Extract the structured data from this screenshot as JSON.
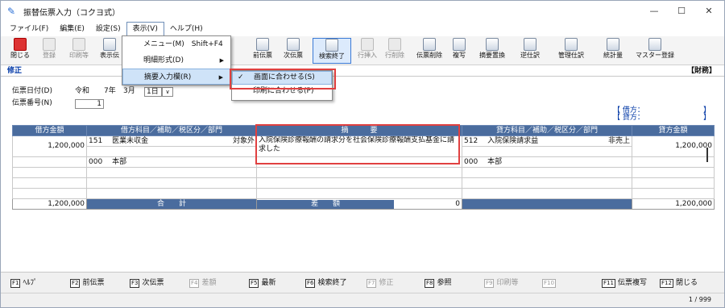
{
  "window": {
    "title": "振替伝票入力（コクヨ式）",
    "min": "—",
    "max": "☐",
    "close": "✕"
  },
  "menu": [
    "ファイル(F)",
    "編集(E)",
    "設定(S)",
    "表示(V)",
    "ヘルプ(H)"
  ],
  "toolbar": [
    "閉じる",
    "登録",
    "印刷等",
    "表示伝",
    "前伝票",
    "次伝票",
    "検索終了",
    "行挿入",
    "行削除",
    "伝票削除",
    "複写",
    "摘要置換",
    "逆仕訳",
    "管理仕訳",
    "統計量",
    "マスター登録"
  ],
  "mode": "修正",
  "dept": "【財務】",
  "header": {
    "date_label": "伝票日付(D)",
    "era": "令和",
    "year": "7年",
    "month": "3月",
    "day": "1日",
    "number_label": "伝票番号(N)",
    "number": "1"
  },
  "side": {
    "debit_label": "【 借方：",
    "credit_label": "【 貸方：",
    "close": "】"
  },
  "grid": {
    "cols": [
      "借方金額",
      "借方科目／補助／税区分／部門",
      "摘　　　要",
      "貸方科目／補助／税区分／部門",
      "貸方金額"
    ],
    "debit_amount": "1,200,000",
    "debit_code": "151",
    "debit_account": "医業未収金",
    "debit_tax": "対象外",
    "debit_dept_code": "000",
    "debit_dept": "本部",
    "memo": "入院保険診療報酬の請求分を社会保険診療報酬支払基金に請求した",
    "credit_code": "512",
    "credit_account": "入院保険請求益",
    "credit_tax": "非売上",
    "credit_amount": "1,200,000",
    "credit_dept_code": "000",
    "credit_dept": "本部",
    "total_debit": "1,200,000",
    "total_label": "合　　計",
    "diff_label": "差　　額",
    "diff": "0",
    "total_credit": "1,200,000"
  },
  "view_menu": [
    "メニュー(M)　Shift+F4",
    "明細形式(D)",
    "摘要入力欄(R)"
  ],
  "submenu": [
    "画面に合わせる(S)",
    "印刷に合わせる(P)"
  ],
  "fkeys": [
    [
      "F1",
      "ﾍﾙﾌﾟ"
    ],
    [
      "F2",
      "前伝票"
    ],
    [
      "F3",
      "次伝票"
    ],
    [
      "F4",
      "差額"
    ],
    [
      "F5",
      "最新"
    ],
    [
      "F6",
      "検索終了"
    ],
    [
      "F7",
      "修正"
    ],
    [
      "F8",
      "参照"
    ],
    [
      "F9",
      "印刷等"
    ],
    [
      "F10",
      ""
    ],
    [
      "F11",
      "伝票複写"
    ],
    [
      "F12",
      "閉じる"
    ]
  ],
  "status_page": "1 / 999"
}
